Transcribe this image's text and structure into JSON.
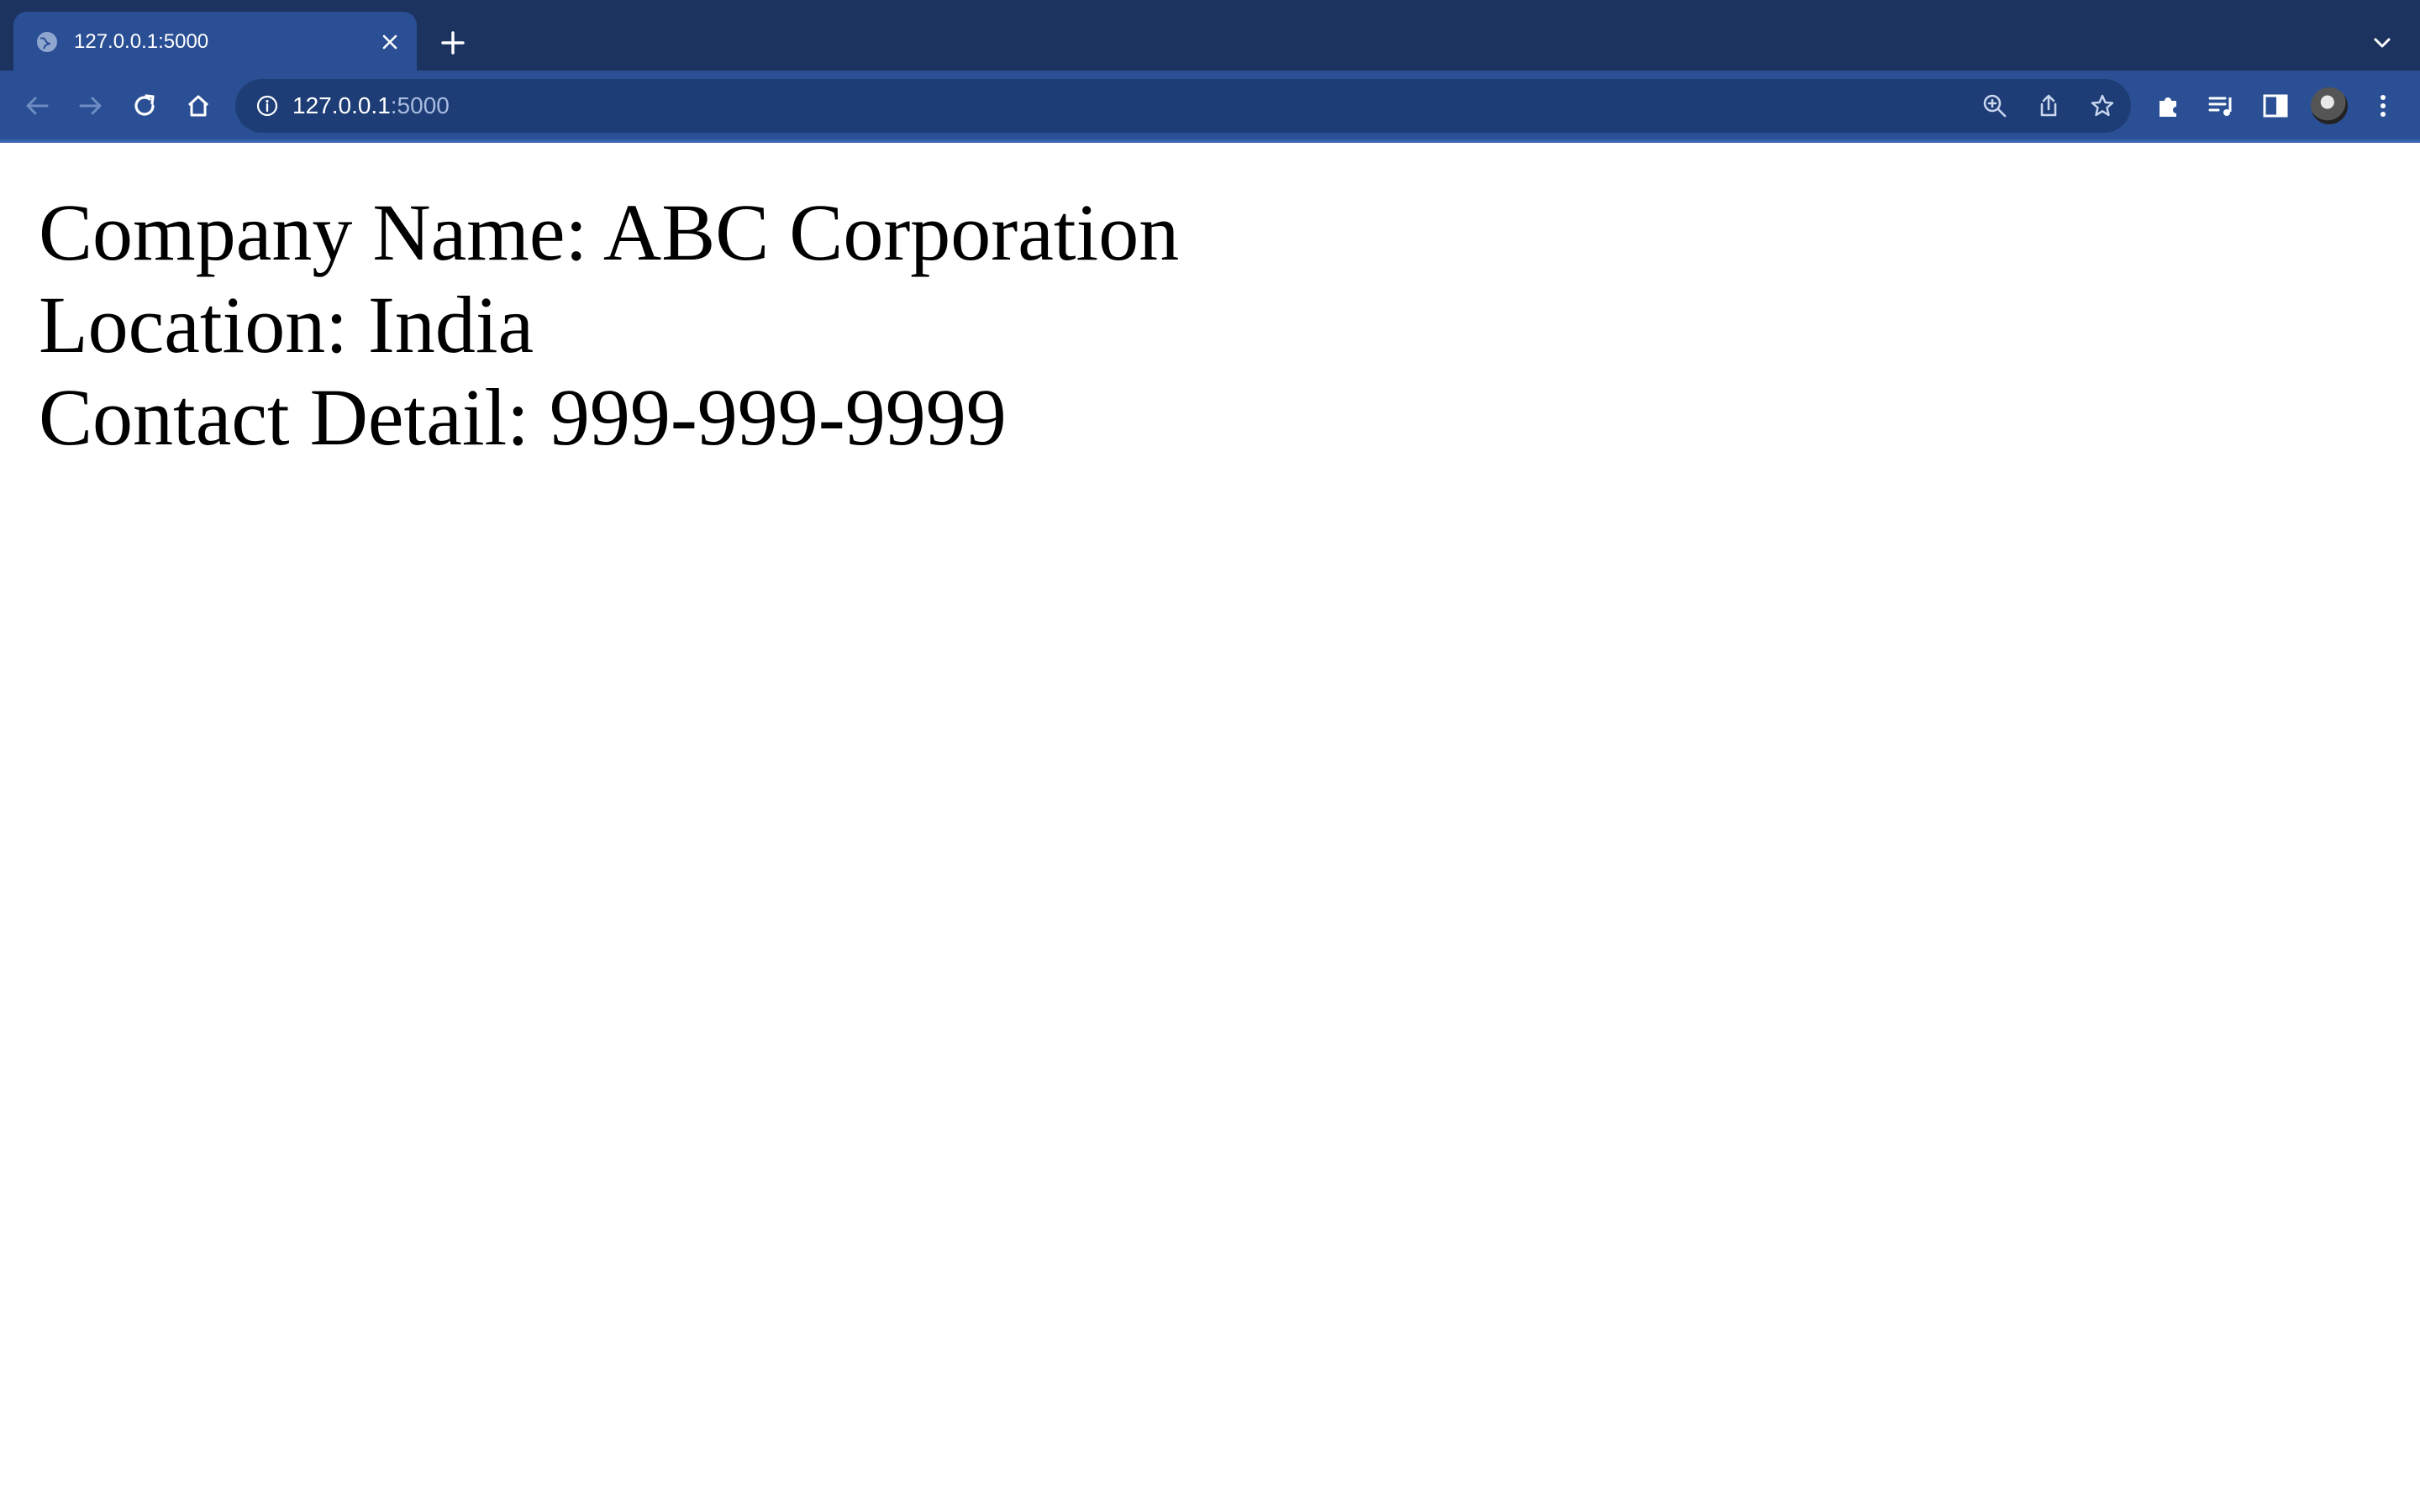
{
  "browser": {
    "tab": {
      "title": "127.0.0.1:5000"
    },
    "address_bar": {
      "host": "127.0.0.1",
      "port": ":5000"
    }
  },
  "page": {
    "lines": [
      "Company Name: ABC Corporation",
      "Location: India",
      "Contact Detail: 999-999-9999"
    ]
  },
  "colors": {
    "tabstrip_bg": "#1c3360",
    "toolbar_bg": "#2a4f94",
    "omnibox_bg": "#1e3d76"
  }
}
